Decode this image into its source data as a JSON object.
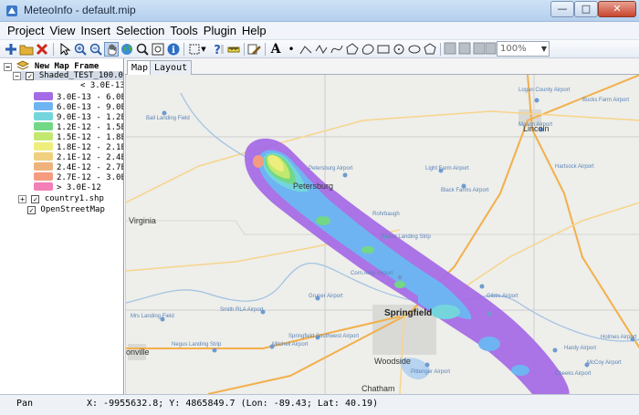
{
  "window": {
    "title": "MeteoInfo - default.mip",
    "min": "—",
    "max": "□",
    "close": "✕"
  },
  "menu": [
    "Project",
    "View",
    "Insert",
    "Selection",
    "Tools",
    "Plugin",
    "Help"
  ],
  "toolbar": {
    "zoom_value": "100%"
  },
  "legend": {
    "frame": "New Map Frame",
    "layers": {
      "shaded": "Shaded_TEST_100.0_1",
      "country": "country1.shp",
      "osm": "OpenStreetMap"
    },
    "items": [
      {
        "label": "< 3.0E-13",
        "color": "#ffffff"
      },
      {
        "label": "3.0E-13 - 6.0E",
        "color": "#a56be6"
      },
      {
        "label": "6.0E-13 - 9.0E",
        "color": "#6fb4f2"
      },
      {
        "label": "9.0E-13 - 1.2E",
        "color": "#74d6dc"
      },
      {
        "label": "1.2E-12 - 1.5E",
        "color": "#72d886"
      },
      {
        "label": "1.5E-12 - 1.8E",
        "color": "#c3e870"
      },
      {
        "label": "1.8E-12 - 2.1E",
        "color": "#eeee7c"
      },
      {
        "label": "2.1E-12 - 2.4E",
        "color": "#f0cf7e"
      },
      {
        "label": "2.4E-12 - 2.7E",
        "color": "#f0b27c"
      },
      {
        "label": "2.7E-12 - 3.0E",
        "color": "#f49b80"
      },
      {
        "label": "> 3.0E-12",
        "color": "#f27fb7"
      }
    ]
  },
  "tabs": [
    "Map",
    "Layout"
  ],
  "map": {
    "labels": {
      "springfield": "Springfield",
      "petersburg": "Petersburg",
      "virginia": "Virginia",
      "woodside": "Woodside",
      "chatham": "Chatham",
      "lincoln": "Lincoln",
      "jacksonville": "onville",
      "lincoln_airport": "Logan County Airport",
      "mason_airport": "Mason Airport",
      "ball_landing": "Ball Landing Field",
      "petersburg_airport": "Petersburg Airport",
      "light_farm": "Light Farm Airport",
      "black_farms": "Black Farms Airport",
      "rohrbaugh": "Rohrbaugh",
      "fisher_landing": "Fisher Landing Strip",
      "hartsock": "Hartsock Airport",
      "corn_alley": "Corn Alley Airport",
      "gruner": "Gruner Airport",
      "smith_rla": "Smith RLA Airport",
      "springfield_southwest": "Springfield Southwest Airport",
      "mitchell": "Mitchell Airport",
      "negus": "Negus Landing Strip",
      "bucks_farm": "Bucks Farm Airport",
      "hardy": "Hardy Airport",
      "mccoy": "McCoy Airport",
      "gibbs": "Gibbs Airport",
      "holmes": "Holmes Airport",
      "pittenger": "Pittenger Airport",
      "cheeks": "Cheeks Airport",
      "mrs_landing": "Mrs Landing Field"
    },
    "colors": {
      "band1": "#a56be6",
      "band2": "#6fb4f2",
      "band3": "#74d6dc",
      "band4": "#72d886",
      "band5": "#c3e870",
      "band6": "#eeee7c",
      "band9": "#f49b80"
    }
  },
  "status": {
    "mode": "Pan",
    "coords": "X: -9955632.8; Y: 4865849.7 (Lon: -89.43; Lat: 40.19)"
  }
}
